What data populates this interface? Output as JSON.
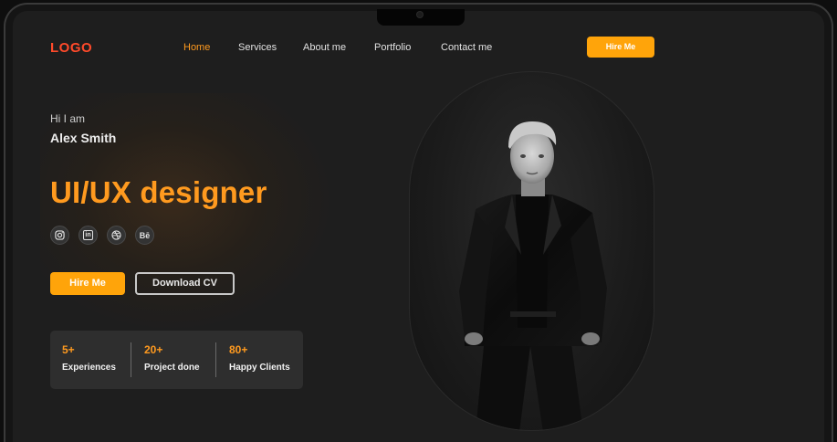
{
  "nav": {
    "logo": "LOGO",
    "items": [
      {
        "label": "Home",
        "active": true
      },
      {
        "label": "Services"
      },
      {
        "label": "About me"
      },
      {
        "label": "Portfolio"
      },
      {
        "label": "Contact me"
      }
    ],
    "hire_label": "Hire Me"
  },
  "hero": {
    "greeting": "Hi I am",
    "name": "Alex Smith",
    "role": "UI/UX designer",
    "socials": [
      {
        "icon": "instagram-icon"
      },
      {
        "icon": "linkedin-icon",
        "glyph": "in"
      },
      {
        "icon": "dribbble-icon"
      },
      {
        "icon": "behance-icon",
        "glyph": "Bē"
      }
    ],
    "hire_label": "Hire Me",
    "cv_label": "Download CV"
  },
  "stats": [
    {
      "value": "5+",
      "label": "Experiences"
    },
    {
      "value": "20+",
      "label": "Project done"
    },
    {
      "value": "80+",
      "label": "Happy Clients"
    }
  ],
  "colors": {
    "accent": "#ffa40a",
    "accent_text": "#ff9a1f",
    "logo": "#ff4a2a",
    "background": "#1e1e1e"
  }
}
